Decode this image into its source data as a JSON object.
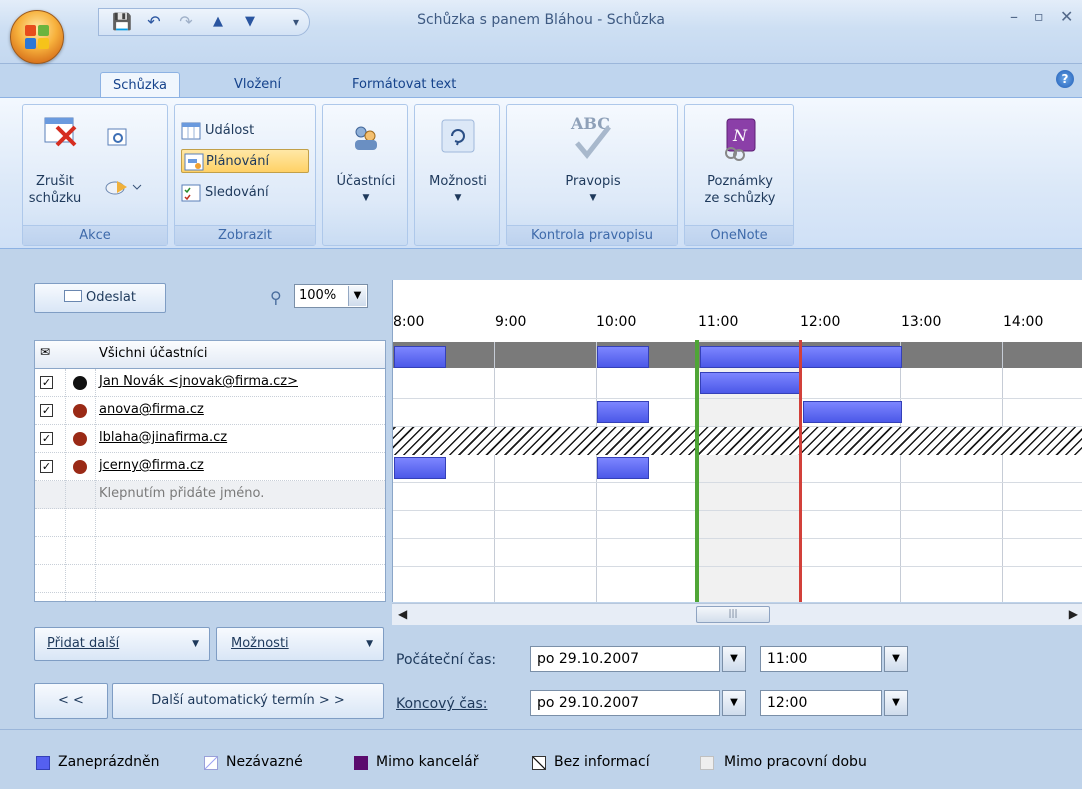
{
  "window": {
    "title": "Schůzka s panem Bláhou - Schůzka"
  },
  "tabs": [
    "Schůzka",
    "Vložení",
    "Formátovat text"
  ],
  "ribbon": {
    "akce": {
      "cancel_label": "Zrušit\nschůzku",
      "group_label": "Akce"
    },
    "zobrazit": {
      "items": [
        "Událost",
        "Plánování",
        "Sledování"
      ],
      "group_label": "Zobrazit"
    },
    "attendees_label": "Účastníci",
    "options_label": "Možnosti",
    "spelling": {
      "label": "Pravopis",
      "group_label": "Kontrola pravopisu"
    },
    "onenote": {
      "label": "Poznámky\nze schůzky",
      "group_label": "OneNote"
    }
  },
  "scheduling": {
    "send_label": "Odeslat",
    "zoom": "100%",
    "all_attendees": "Všichni účastníci",
    "attendees": [
      {
        "name": "Jan Novák <jnovak@firma.cz>",
        "checked": true,
        "role": "organizer"
      },
      {
        "name": "anova@firma.cz",
        "checked": true,
        "role": "required"
      },
      {
        "name": "lblaha@jinafirma.cz",
        "checked": true,
        "role": "required"
      },
      {
        "name": "jcerny@firma.cz",
        "checked": true,
        "role": "required"
      }
    ],
    "add_name_placeholder": "Klepnutím přidáte jméno.",
    "hours": [
      "8:00",
      "9:00",
      "10:00",
      "11:00",
      "12:00",
      "13:00",
      "14:00"
    ],
    "add_others_label": "Přidat další",
    "options_label": "Možnosti",
    "prev_label": "< <",
    "next_label": "Další automatický termín > >",
    "start": {
      "label": "Počáteční čas:",
      "date": "po 29.10.2007",
      "time": "11:00"
    },
    "end": {
      "label": "Koncový čas:",
      "date": "po 29.10.2007",
      "time": "12:00"
    }
  },
  "legend": [
    "Zaneprázdněn",
    "Nezávazné",
    "Mimo kancelář",
    "Bez informací",
    "Mimo pracovní dobu"
  ],
  "colors": {
    "busy": "#5560f0",
    "out_of_office": "#5b0b6e",
    "start_line": "#4fa536",
    "end_line": "#d2403a"
  }
}
